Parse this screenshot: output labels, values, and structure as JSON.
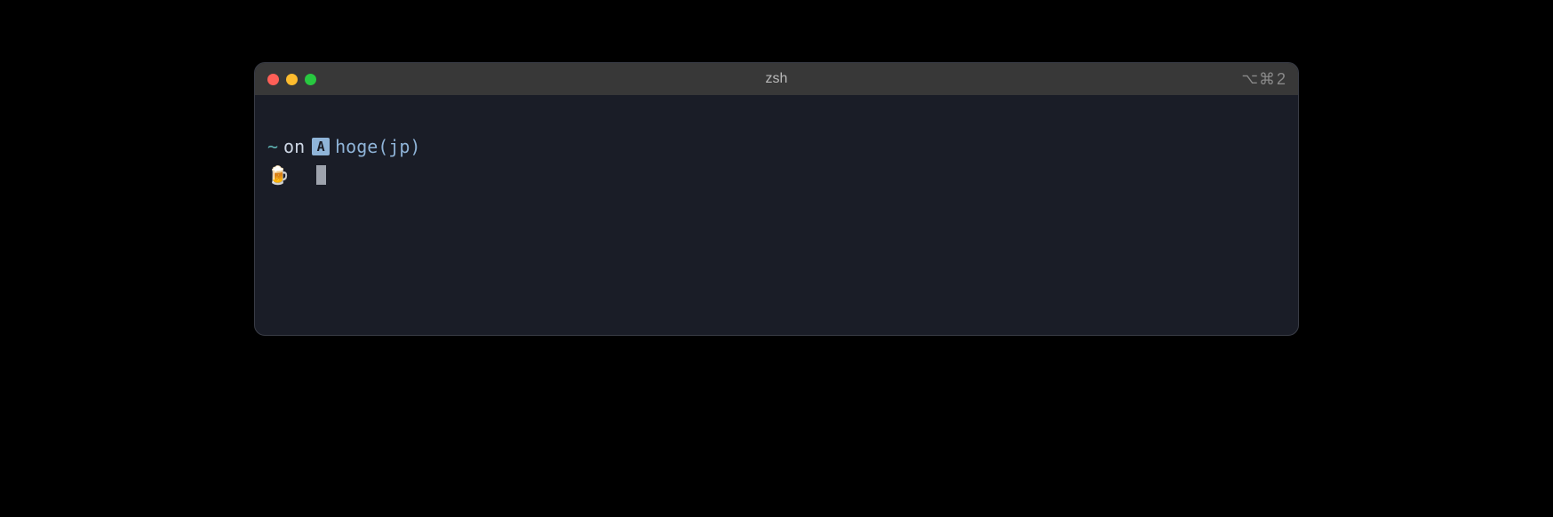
{
  "window": {
    "title": "zsh",
    "shortcut_option": "⌥",
    "shortcut_cmd": "⌘",
    "shortcut_num": "2"
  },
  "prompt": {
    "cwd": "~",
    "on": "on",
    "badge": "A",
    "context": "hoge(jp)",
    "emoji": "🍺"
  }
}
